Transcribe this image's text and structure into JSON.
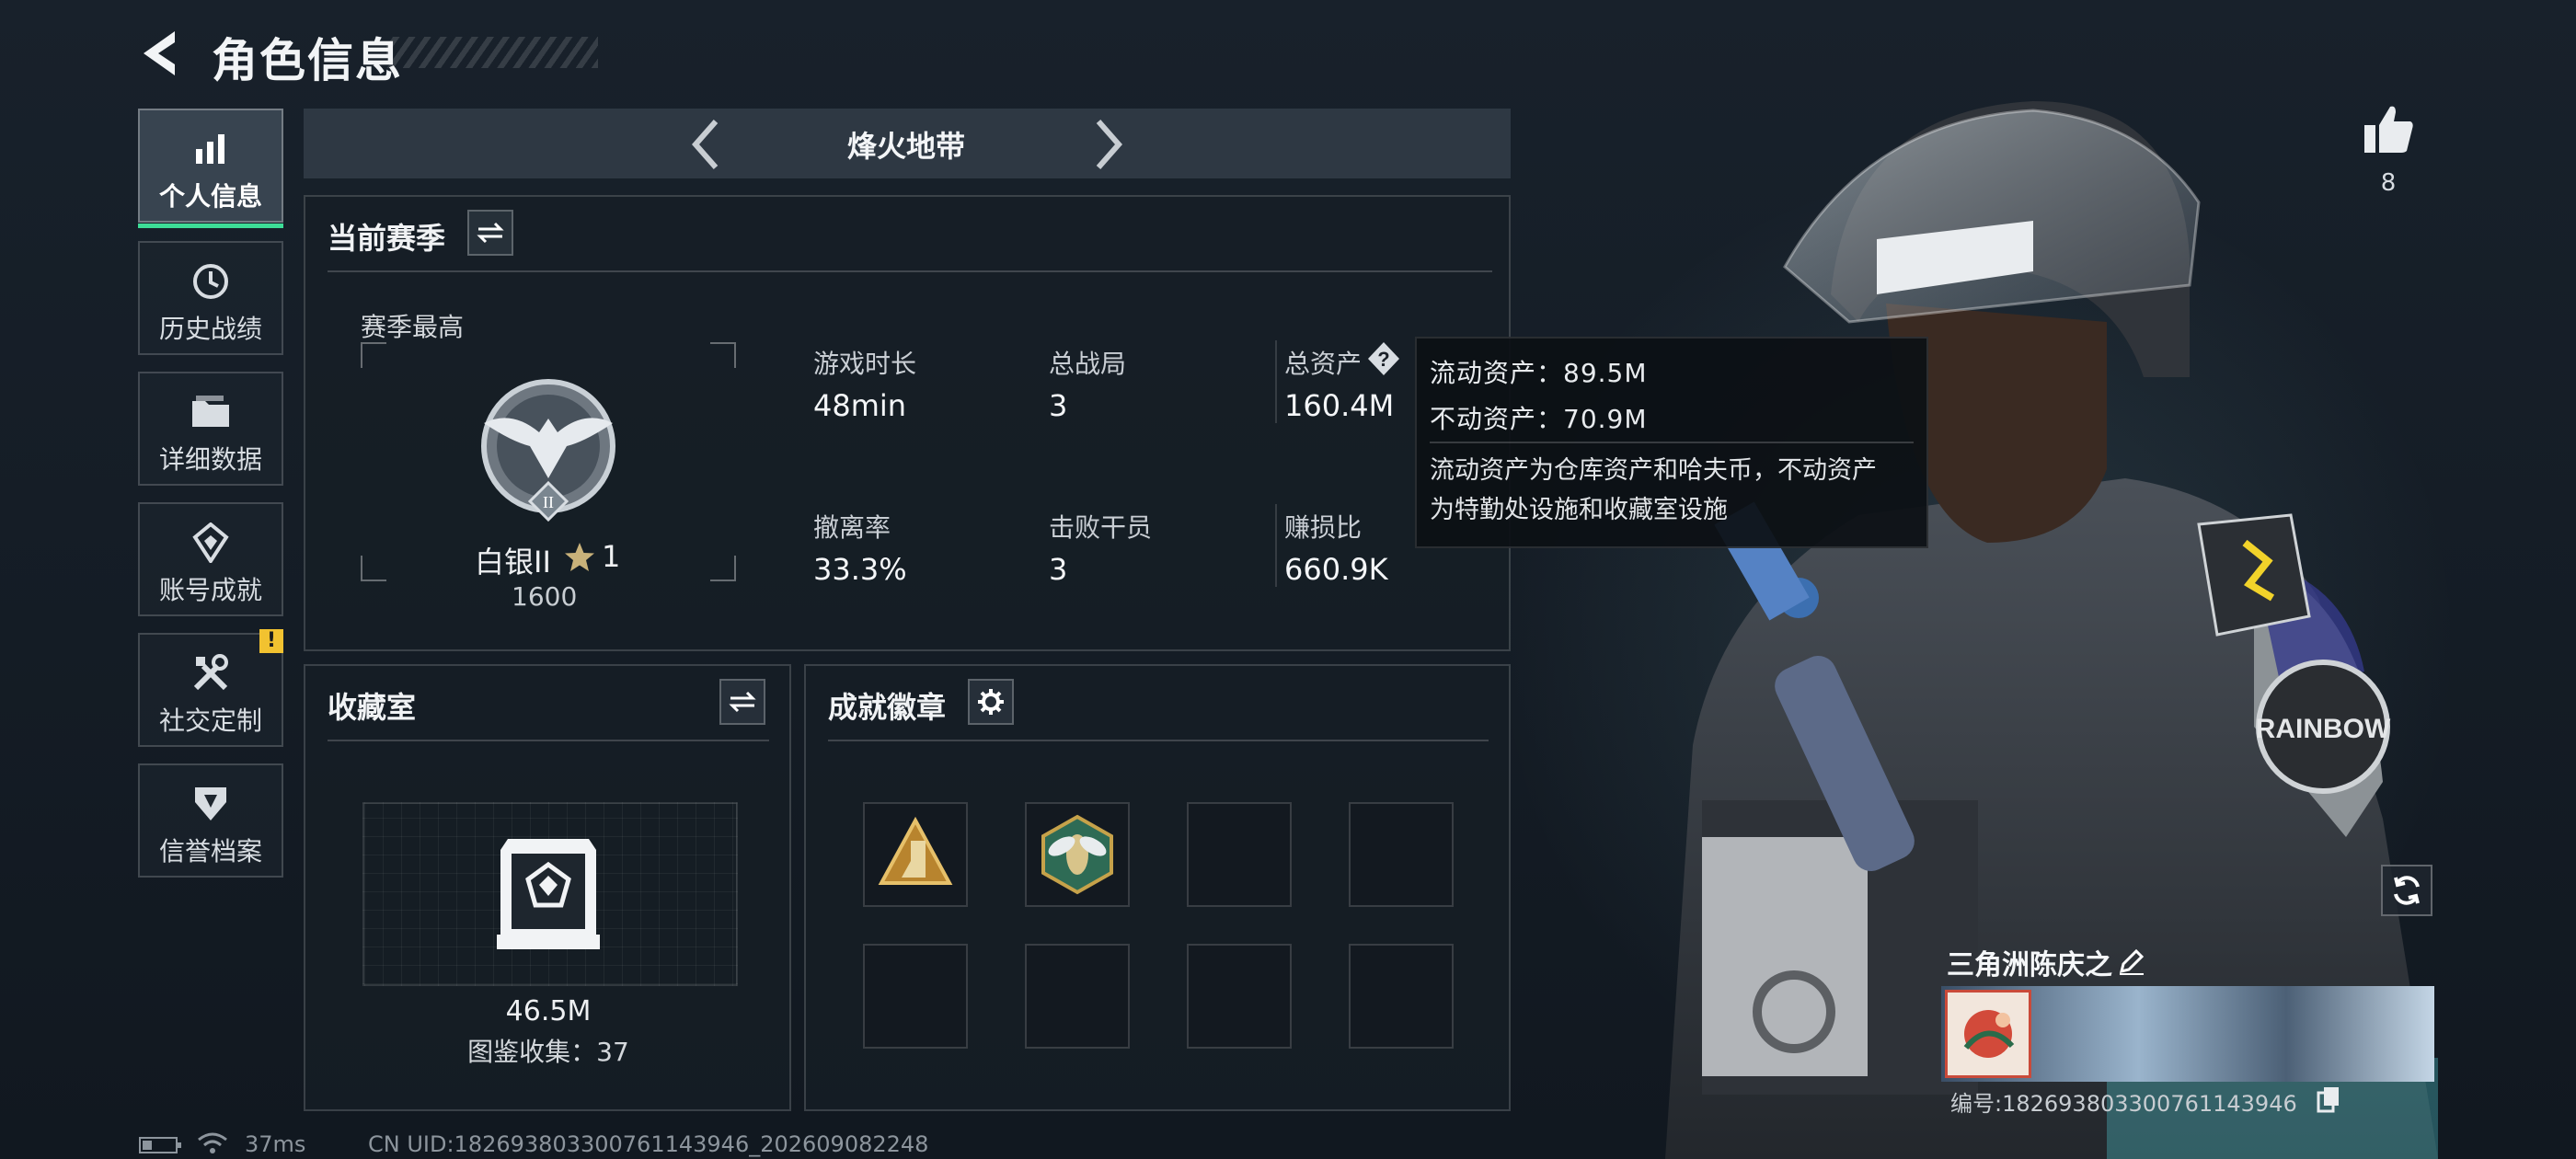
{
  "header": {
    "title": "角色信息"
  },
  "sidebar": {
    "items": [
      {
        "label": "个人信息",
        "icon": "bar-chart-icon",
        "active": true
      },
      {
        "label": "历史战绩",
        "icon": "history-icon"
      },
      {
        "label": "详细数据",
        "icon": "folder-icon"
      },
      {
        "label": "账号成就",
        "icon": "achievement-icon"
      },
      {
        "label": "社交定制",
        "icon": "tools-icon",
        "badge": "!"
      },
      {
        "label": "信誉档案",
        "icon": "shield-icon"
      }
    ]
  },
  "mode": {
    "title": "烽火地带"
  },
  "season": {
    "title": "当前赛季",
    "peak_label": "赛季最高",
    "rank_name": "白银II",
    "rank_stars": "1",
    "rank_score": "1600",
    "stats": [
      {
        "label": "游戏时长",
        "value": "48min"
      },
      {
        "label": "总战局",
        "value": "3"
      },
      {
        "label": "总资产",
        "value": "160.4M"
      },
      {
        "label": "撤离率",
        "value": "33.3%"
      },
      {
        "label": "击败干员",
        "value": "3"
      },
      {
        "label": "赚损比",
        "value": "660.9K"
      }
    ]
  },
  "tooltip": {
    "liquid": "流动资产：89.5M",
    "fixed": "不动资产：70.9M",
    "desc_line1": "流动资产为仓库资产和哈夫币，不动资产",
    "desc_line2": "为特勤处设施和收藏室设施"
  },
  "collection": {
    "title": "收藏室",
    "value": "46.5M",
    "count_text": "图鉴收集：37"
  },
  "badges": {
    "title": "成就徽章",
    "slots": [
      {
        "icon": "triangle-badge-icon",
        "filled": true
      },
      {
        "icon": "wasp-badge-icon",
        "filled": true
      },
      {
        "filled": false
      },
      {
        "filled": false
      },
      {
        "filled": false
      },
      {
        "filled": false
      },
      {
        "filled": false
      },
      {
        "filled": false
      }
    ]
  },
  "likes": {
    "count": "8"
  },
  "profile": {
    "name": "三角洲陈庆之",
    "id_text": "编号:1826938033007611439​46"
  },
  "footer": {
    "ping": "37ms",
    "uid": "CN UID:1826938033007611439​46_202609082248"
  },
  "colors": {
    "accent": "#3ddc97",
    "alert": "#f2c230",
    "background": "#151c24"
  }
}
